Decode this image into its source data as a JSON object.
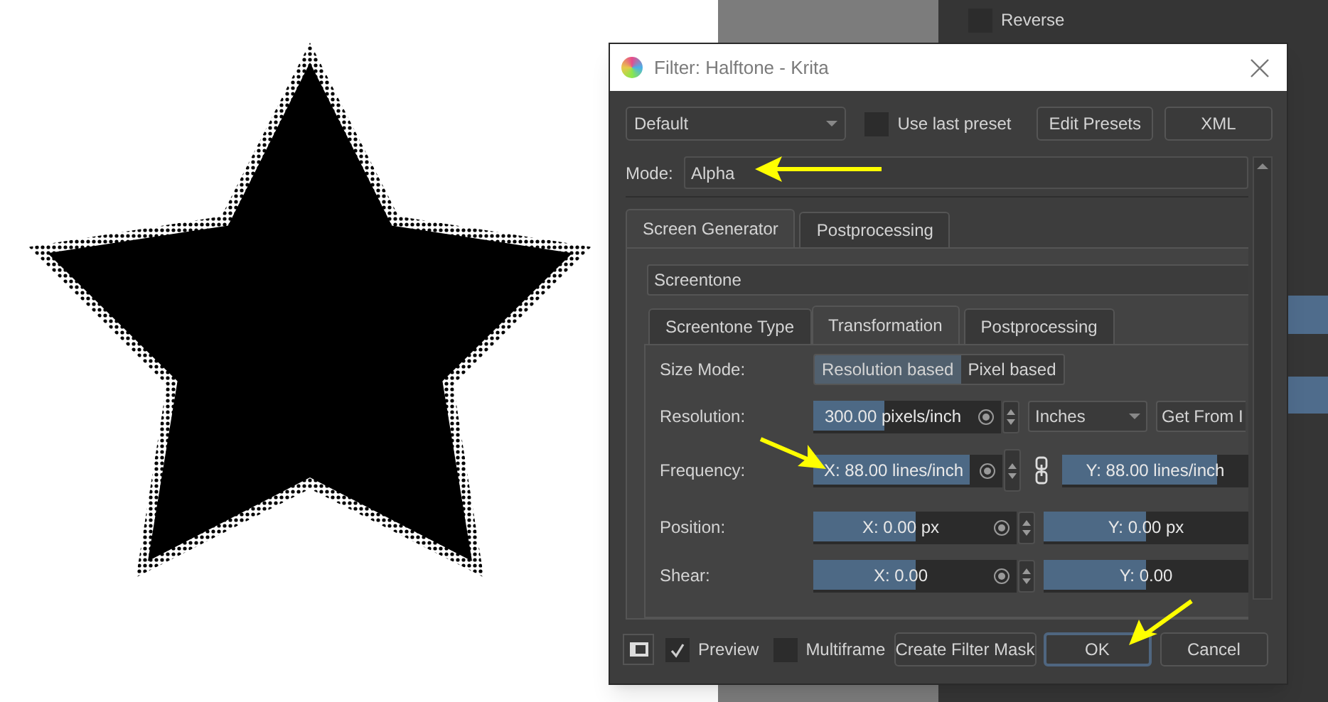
{
  "background_panel": {
    "checkbox": {
      "label": "Reverse",
      "checked": false
    }
  },
  "dialog": {
    "title": "Filter: Halftone - Krita",
    "preset": {
      "value": "Default"
    },
    "use_last_preset": {
      "label": "Use last preset",
      "checked": false
    },
    "top_buttons": [
      "Edit Presets",
      "XML"
    ],
    "mode": {
      "label": "Mode:",
      "value": "Alpha"
    },
    "tabs": [
      {
        "label": "Screen Generator",
        "selected": true
      },
      {
        "label": "Postprocessing",
        "selected": false
      }
    ],
    "generator": {
      "value": "Screentone"
    },
    "subtabs": [
      {
        "label": "Screentone Type",
        "selected": false
      },
      {
        "label": "Transformation",
        "selected": true
      },
      {
        "label": "Postprocessing",
        "selected": false
      }
    ],
    "size_mode": {
      "label": "Size Mode:",
      "options": [
        {
          "label": "Resolution based",
          "selected": true
        },
        {
          "label": "Pixel based",
          "selected": false
        }
      ]
    },
    "resolution": {
      "label": "Resolution:",
      "value": "300.00 pixels/inch",
      "level": 0.38,
      "unit": "Inches",
      "button": "Get From I"
    },
    "pairs": [
      {
        "label": "Frequency:",
        "kind": "linked",
        "x": {
          "value": "X: 88.00 lines/inch",
          "level": 0.83
        },
        "y": {
          "value": "Y: 88.00 lines/inch",
          "level": 0.83
        }
      },
      {
        "label": "Position:",
        "kind": "plain",
        "x": {
          "value": "X: 0.00 px",
          "level": 0.5
        },
        "y": {
          "value": "Y: 0.00 px",
          "level": 0.5
        }
      },
      {
        "label": "Shear:",
        "kind": "plain",
        "x": {
          "value": "X: 0.00",
          "level": 0.5
        },
        "y": {
          "value": "Y: 0.00",
          "level": 0.5
        }
      }
    ],
    "footer": {
      "preview": {
        "label": "Preview",
        "checked": true
      },
      "multiframe": {
        "label": "Multiframe",
        "checked": false
      },
      "buttons": [
        {
          "label": "Create Filter Mask",
          "focused": false
        },
        {
          "label": "OK",
          "focused": true
        },
        {
          "label": "Cancel",
          "focused": false
        }
      ]
    }
  }
}
